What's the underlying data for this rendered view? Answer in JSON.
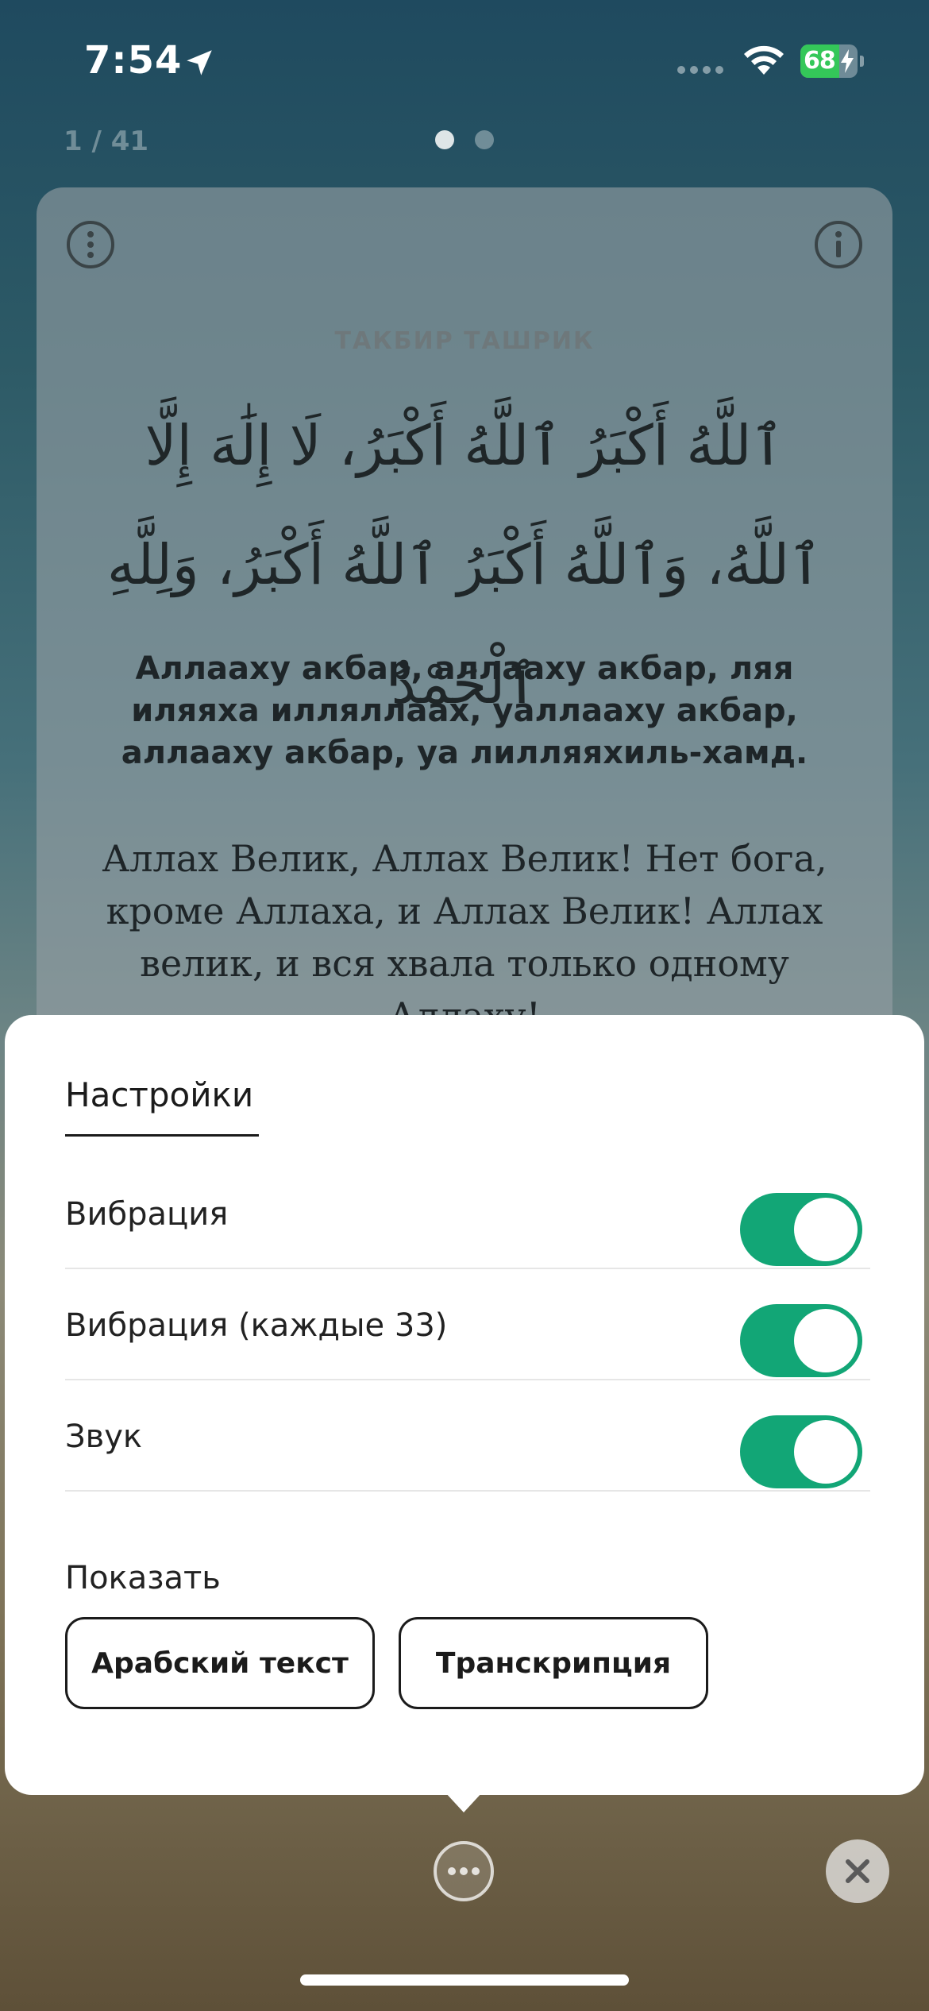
{
  "status_bar": {
    "time": "7:54",
    "battery_percent": "68",
    "battery_level": 0.68,
    "battery_color": "#34c759",
    "icons": [
      "location-arrow-icon",
      "cellular-dots-icon",
      "wifi-icon",
      "battery-icon",
      "charging-bolt-icon"
    ]
  },
  "pager": {
    "counter": "1 / 41",
    "dots_total": 2,
    "active_dot": 0
  },
  "card": {
    "title": "ТАКБИР ТАШРИК",
    "arabic": "ٱللَّهُ أَكْبَرُ ٱللَّهُ أَكْبَرُ، لَا إِلَٰهَ إِلَّا ٱللَّهُ، وَٱللَّهُ أَكْبَرُ ٱللَّهُ أَكْبَرُ، وَلِلَّهِ ٱلْحَمْدُ",
    "transcription": "Аллааху акбар, аллааху акбар, ляя иляяха илляллаах, уаллааху акбар, аллааху акбар, уа лилляяхиль-хамд.",
    "translation": "Аллах Велик, Аллах Велик! Нет бога, кроме Аллаха, и Аллах Велик! Аллах велик, и вся хвала только одному Аллаху!",
    "icons": [
      "more-vertical-icon",
      "info-icon"
    ]
  },
  "settings": {
    "tab": "Настройки",
    "rows": [
      {
        "label": "Вибрация",
        "enabled": true
      },
      {
        "label": "Вибрация (каждые 33)",
        "enabled": true
      },
      {
        "label": "Звук",
        "enabled": true
      }
    ],
    "show_label": "Показать",
    "chips": [
      {
        "label": "Арабский текст"
      },
      {
        "label": "Транскрипция"
      }
    ],
    "accent_color": "#12a676"
  },
  "controls": {
    "icons": [
      "more-horizontal-icon",
      "close-icon"
    ]
  }
}
